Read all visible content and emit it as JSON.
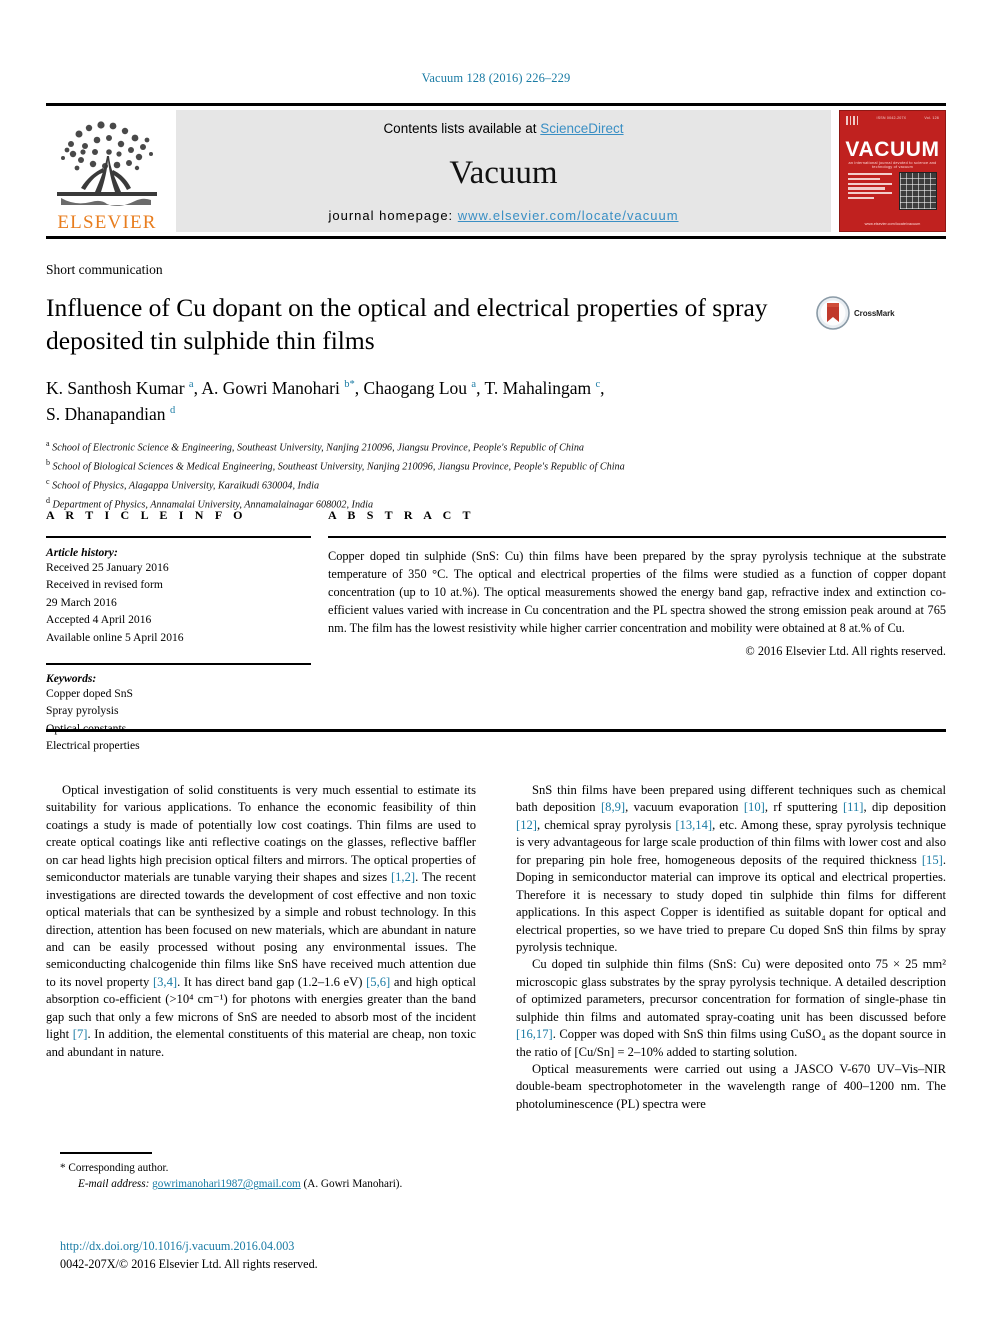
{
  "running_head": "Vacuum 128 (2016) 226–229",
  "masthead": {
    "publisher_name": "ELSEVIER",
    "publisher_logo_icon": "elsevier-tree-logo",
    "contents_prefix": "Contents lists available at ",
    "contents_link": "ScienceDirect",
    "journal_name": "Vacuum",
    "homepage_prefix": "journal homepage: ",
    "homepage_link": "www.elsevier.com/locate/vacuum",
    "cover": {
      "title": "VACUUM",
      "subtitle": "an international journal devoted to science and technology of vacuum",
      "footer": "www.elsevier.com/locate/vacuum",
      "background_color": "#c0211f"
    }
  },
  "article": {
    "type_label": "Short communication",
    "title": "Influence of Cu dopant on the optical and electrical properties of spray deposited tin sulphide thin films",
    "crossmark_label": "CrossMark",
    "authors": [
      {
        "name": "K. Santhosh Kumar",
        "marks": "a",
        "sep": ", "
      },
      {
        "name": "A. Gowri Manohari",
        "marks": "b",
        "star": "*",
        "sep": ", "
      },
      {
        "name": "Chaogang Lou",
        "marks": "a",
        "sep": ", "
      },
      {
        "name": "T. Mahalingam",
        "marks": "c",
        "sep": ", "
      },
      {
        "name": "S. Dhanapandian",
        "marks": "d",
        "sep": ""
      }
    ],
    "affiliations": [
      {
        "mark": "a",
        "text": "School of Electronic Science & Engineering, Southeast University, Nanjing 210096, Jiangsu Province, People's Republic of China"
      },
      {
        "mark": "b",
        "text": "School of Biological Sciences & Medical Engineering, Southeast University, Nanjing 210096, Jiangsu Province, People's Republic of China"
      },
      {
        "mark": "c",
        "text": "School of Physics, Alagappa University, Karaikudi 630004, India"
      },
      {
        "mark": "d",
        "text": "Department of Physics, Annamalai University, Annamalainagar 608002, India"
      }
    ]
  },
  "article_info": {
    "heading": "A R T I C L E  I N F O",
    "history_label": "Article history:",
    "history": [
      "Received 25 January 2016",
      "Received in revised form",
      "29 March 2016",
      "Accepted 4 April 2016",
      "Available online 5 April 2016"
    ],
    "keywords_label": "Keywords:",
    "keywords": [
      "Copper doped SnS",
      "Spray pyrolysis",
      "Optical constants",
      "Electrical properties"
    ]
  },
  "abstract": {
    "heading": "A B S T R A C T",
    "text": "Copper doped tin sulphide (SnS: Cu) thin films have been prepared by the spray pyrolysis technique at the substrate temperature of 350 °C. The optical and electrical properties of the films were studied as a function of copper dopant concentration (up to 10 at.%). The optical measurements showed the energy band gap, refractive index and extinction co-efficient values varied with increase in Cu concentration and the PL spectra showed the strong emission peak around at 765 nm. The film has the lowest resistivity while higher carrier concentration and mobility were obtained at 8 at.% of Cu.",
    "copyright": "© 2016 Elsevier Ltd. All rights reserved."
  },
  "body": {
    "left_column": [
      {
        "parts": [
          {
            "t": "Optical investigation of solid constituents is very much essential to estimate its suitability for various applications. To enhance the economic feasibility of thin coatings a study is made of potentially low cost coatings. Thin films are used to create optical coatings like anti reflective coatings on the glasses, reflective baffler on car head lights high precision optical filters and mirrors. The optical properties of semiconductor materials are tunable varying their shapes and sizes "
          },
          {
            "t": "[1,2]",
            "ref": true
          },
          {
            "t": ". The recent investigations are directed towards the development of cost effective and non toxic optical materials that can be synthesized by a simple and robust technology. In this direction, attention has been focused on new materials, which are abundant in nature and can be easily processed without posing any environmental issues. The semiconducting chalcogenide thin films like SnS have received much attention due to its novel property "
          },
          {
            "t": "[3,4]",
            "ref": true
          },
          {
            "t": ". It has direct band gap (1.2–1.6 eV) "
          },
          {
            "t": "[5,6]",
            "ref": true
          },
          {
            "t": " and high optical absorption co-efficient (>10⁴ cm⁻¹) for photons with energies greater than the band gap such that only a few microns of SnS are needed to absorb most of the incident light "
          },
          {
            "t": "[7]",
            "ref": true
          },
          {
            "t": ". In addition, the elemental constituents of this material are cheap, non toxic and abundant in nature."
          }
        ]
      }
    ],
    "right_column": [
      {
        "parts": [
          {
            "t": "SnS thin films have been prepared using different techniques such as chemical bath deposition "
          },
          {
            "t": "[8,9]",
            "ref": true
          },
          {
            "t": ", vacuum evaporation "
          },
          {
            "t": "[10]",
            "ref": true
          },
          {
            "t": ", rf sputtering "
          },
          {
            "t": "[11]",
            "ref": true
          },
          {
            "t": ", dip deposition "
          },
          {
            "t": "[12]",
            "ref": true
          },
          {
            "t": ", chemical spray pyrolysis "
          },
          {
            "t": "[13,14]",
            "ref": true
          },
          {
            "t": ", etc. Among these, spray pyrolysis technique is very advantageous for large scale production of thin films with lower cost and also for preparing pin hole free, homogeneous deposits of the required thickness "
          },
          {
            "t": "[15]",
            "ref": true
          },
          {
            "t": ". Doping in semiconductor material can improve its optical and electrical properties. Therefore it is necessary to study doped tin sulphide thin films for different applications. In this aspect Copper is identified as suitable dopant for optical and electrical properties, so we have tried to prepare Cu doped SnS thin films by spray pyrolysis technique."
          }
        ]
      },
      {
        "parts": [
          {
            "t": "Cu doped tin sulphide thin films (SnS: Cu) were deposited onto 75 × 25 mm² microscopic glass substrates by the spray pyrolysis technique. A detailed description of optimized parameters, precursor concentration for formation of single-phase tin sulphide thin films and automated spray-coating unit has been discussed before "
          },
          {
            "t": "[16,17]",
            "ref": true
          },
          {
            "t": ". Copper was doped with SnS thin films using CuSO₄ as the dopant source in the ratio of [Cu/Sn] = 2–10% added to starting solution."
          }
        ]
      },
      {
        "parts": [
          {
            "t": "Optical measurements were carried out using a JASCO V-670 UV–Vis–NIR double-beam spectrophotometer in the wavelength range of 400–1200 nm. The photoluminescence (PL) spectra were"
          }
        ]
      }
    ]
  },
  "footnote": {
    "corresponding": "* Corresponding author.",
    "email_label": "E-mail address:",
    "email": "gowrimanohari1987@gmail.com",
    "email_owner": "(A. Gowri Manohari)."
  },
  "page_footer": {
    "doi": "http://dx.doi.org/10.1016/j.vacuum.2016.04.003",
    "issn_line": "0042-207X/© 2016 Elsevier Ltd. All rights reserved."
  },
  "colors": {
    "link": "#1a7ba4",
    "sd_link": "#3a8fc4",
    "elsevier_orange": "#E87D1E",
    "cover_red": "#c0211f"
  }
}
